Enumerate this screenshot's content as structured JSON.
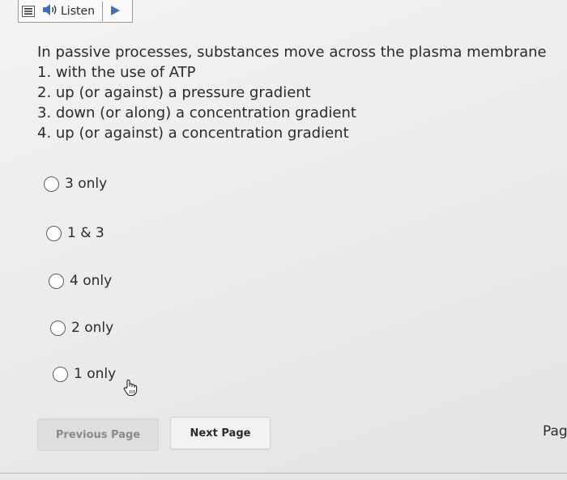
{
  "toolbar": {
    "menu_icon": "menu-icon",
    "speaker_icon": "speaker-icon",
    "listen_label": "Listen",
    "play_icon": "play-icon",
    "accent_color": "#3f6fb5"
  },
  "question": {
    "stem": "In passive processes, substances move across the plasma membrane",
    "statements": [
      "1. with the use of ATP",
      "2. up (or against) a pressure gradient",
      "3. down (or along) a concentration gradient",
      "4. up (or against) a concentration gradient"
    ]
  },
  "options": [
    {
      "label": "3 only",
      "selected": false
    },
    {
      "label": "1 & 3",
      "selected": false
    },
    {
      "label": "4 only",
      "selected": false
    },
    {
      "label": "2 only",
      "selected": false
    },
    {
      "label": "1 only",
      "selected": false
    }
  ],
  "cursor_icon": "hand-pointer-icon",
  "navigation": {
    "previous_label": "Previous Page",
    "next_label": "Next Page",
    "page_label_fragment": "Pag"
  }
}
